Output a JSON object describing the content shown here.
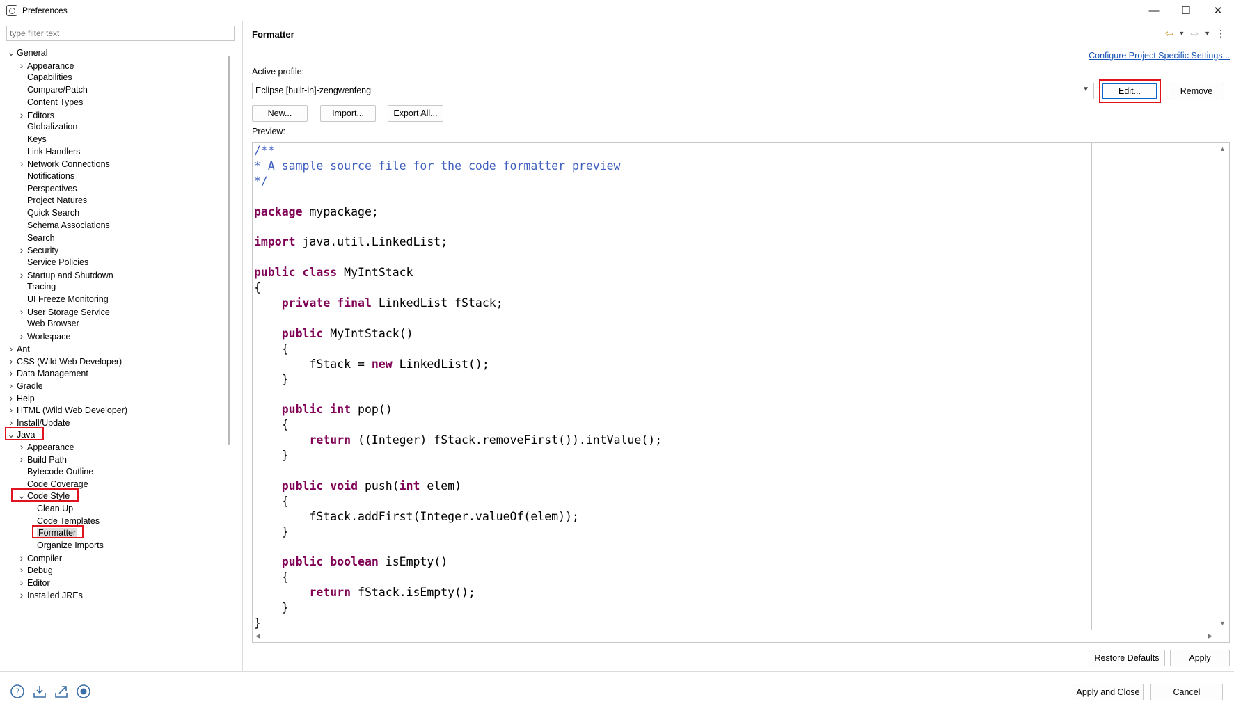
{
  "window": {
    "title": "Preferences",
    "controls": {
      "minimize": "—",
      "maximize": "☐",
      "close": "✕"
    }
  },
  "filter": {
    "placeholder": "type filter text"
  },
  "tree": [
    {
      "label": "General",
      "level": 0,
      "state": "expanded"
    },
    {
      "label": "Appearance",
      "level": 1,
      "state": "collapsed"
    },
    {
      "label": "Capabilities",
      "level": 1,
      "state": "leaf"
    },
    {
      "label": "Compare/Patch",
      "level": 1,
      "state": "leaf"
    },
    {
      "label": "Content Types",
      "level": 1,
      "state": "leaf"
    },
    {
      "label": "Editors",
      "level": 1,
      "state": "collapsed"
    },
    {
      "label": "Globalization",
      "level": 1,
      "state": "leaf"
    },
    {
      "label": "Keys",
      "level": 1,
      "state": "leaf"
    },
    {
      "label": "Link Handlers",
      "level": 1,
      "state": "leaf"
    },
    {
      "label": "Network Connections",
      "level": 1,
      "state": "collapsed"
    },
    {
      "label": "Notifications",
      "level": 1,
      "state": "leaf"
    },
    {
      "label": "Perspectives",
      "level": 1,
      "state": "leaf"
    },
    {
      "label": "Project Natures",
      "level": 1,
      "state": "leaf"
    },
    {
      "label": "Quick Search",
      "level": 1,
      "state": "leaf"
    },
    {
      "label": "Schema Associations",
      "level": 1,
      "state": "leaf"
    },
    {
      "label": "Search",
      "level": 1,
      "state": "leaf"
    },
    {
      "label": "Security",
      "level": 1,
      "state": "collapsed"
    },
    {
      "label": "Service Policies",
      "level": 1,
      "state": "leaf"
    },
    {
      "label": "Startup and Shutdown",
      "level": 1,
      "state": "collapsed"
    },
    {
      "label": "Tracing",
      "level": 1,
      "state": "leaf"
    },
    {
      "label": "UI Freeze Monitoring",
      "level": 1,
      "state": "leaf"
    },
    {
      "label": "User Storage Service",
      "level": 1,
      "state": "collapsed"
    },
    {
      "label": "Web Browser",
      "level": 1,
      "state": "leaf"
    },
    {
      "label": "Workspace",
      "level": 1,
      "state": "collapsed"
    },
    {
      "label": "Ant",
      "level": 0,
      "state": "collapsed"
    },
    {
      "label": "CSS (Wild Web Developer)",
      "level": 0,
      "state": "collapsed"
    },
    {
      "label": "Data Management",
      "level": 0,
      "state": "collapsed"
    },
    {
      "label": "Gradle",
      "level": 0,
      "state": "collapsed"
    },
    {
      "label": "Help",
      "level": 0,
      "state": "collapsed"
    },
    {
      "label": "HTML (Wild Web Developer)",
      "level": 0,
      "state": "collapsed"
    },
    {
      "label": "Install/Update",
      "level": 0,
      "state": "collapsed"
    },
    {
      "label": "Java",
      "level": 0,
      "state": "expanded"
    },
    {
      "label": "Appearance",
      "level": 1,
      "state": "collapsed"
    },
    {
      "label": "Build Path",
      "level": 1,
      "state": "collapsed"
    },
    {
      "label": "Bytecode Outline",
      "level": 1,
      "state": "leaf"
    },
    {
      "label": "Code Coverage",
      "level": 1,
      "state": "leaf"
    },
    {
      "label": "Code Style",
      "level": 1,
      "state": "expanded"
    },
    {
      "label": "Clean Up",
      "level": 2,
      "state": "leaf"
    },
    {
      "label": "Code Templates",
      "level": 2,
      "state": "leaf"
    },
    {
      "label": "Formatter",
      "level": 2,
      "state": "leaf",
      "selected": true
    },
    {
      "label": "Organize Imports",
      "level": 2,
      "state": "leaf"
    },
    {
      "label": "Compiler",
      "level": 1,
      "state": "collapsed"
    },
    {
      "label": "Debug",
      "level": 1,
      "state": "collapsed"
    },
    {
      "label": "Editor",
      "level": 1,
      "state": "collapsed"
    },
    {
      "label": "Installed JREs",
      "level": 1,
      "state": "collapsed"
    }
  ],
  "page": {
    "title": "Formatter",
    "configure_link": "Configure Project Specific Settings...",
    "active_profile_label": "Active profile:",
    "profile_value": "Eclipse [built-in]-zengwenfeng",
    "edit_button": "Edit...",
    "remove_button": "Remove",
    "new_button": "New...",
    "import_button": "Import...",
    "export_button": "Export All...",
    "preview_label": "Preview:",
    "restore_defaults_button": "Restore Defaults",
    "apply_button": "Apply"
  },
  "preview_code": [
    "/**",
    "* A sample source file for the code formatter preview",
    "*/",
    "",
    "package mypackage;",
    "",
    "import java.util.LinkedList;",
    "",
    "public class MyIntStack",
    "{",
    "    private final LinkedList fStack;",
    "",
    "    public MyIntStack()",
    "    {",
    "        fStack = new LinkedList();",
    "    }",
    "",
    "    public int pop()",
    "    {",
    "        return ((Integer) fStack.removeFirst()).intValue();",
    "    }",
    "",
    "    public void push(int elem)",
    "    {",
    "        fStack.addFirst(Integer.valueOf(elem));",
    "    }",
    "",
    "    public boolean isEmpty()",
    "    {",
    "        return fStack.isEmpty();",
    "    }",
    "}"
  ],
  "footer": {
    "apply_close_button": "Apply and Close",
    "cancel_button": "Cancel",
    "icons": [
      "help-icon",
      "import-icon",
      "export-icon",
      "record-icon"
    ]
  },
  "colors": {
    "keyword": "#7f0055",
    "comment": "#3f5fbf",
    "link": "#1a56b8",
    "highlight": "#e0141e"
  }
}
